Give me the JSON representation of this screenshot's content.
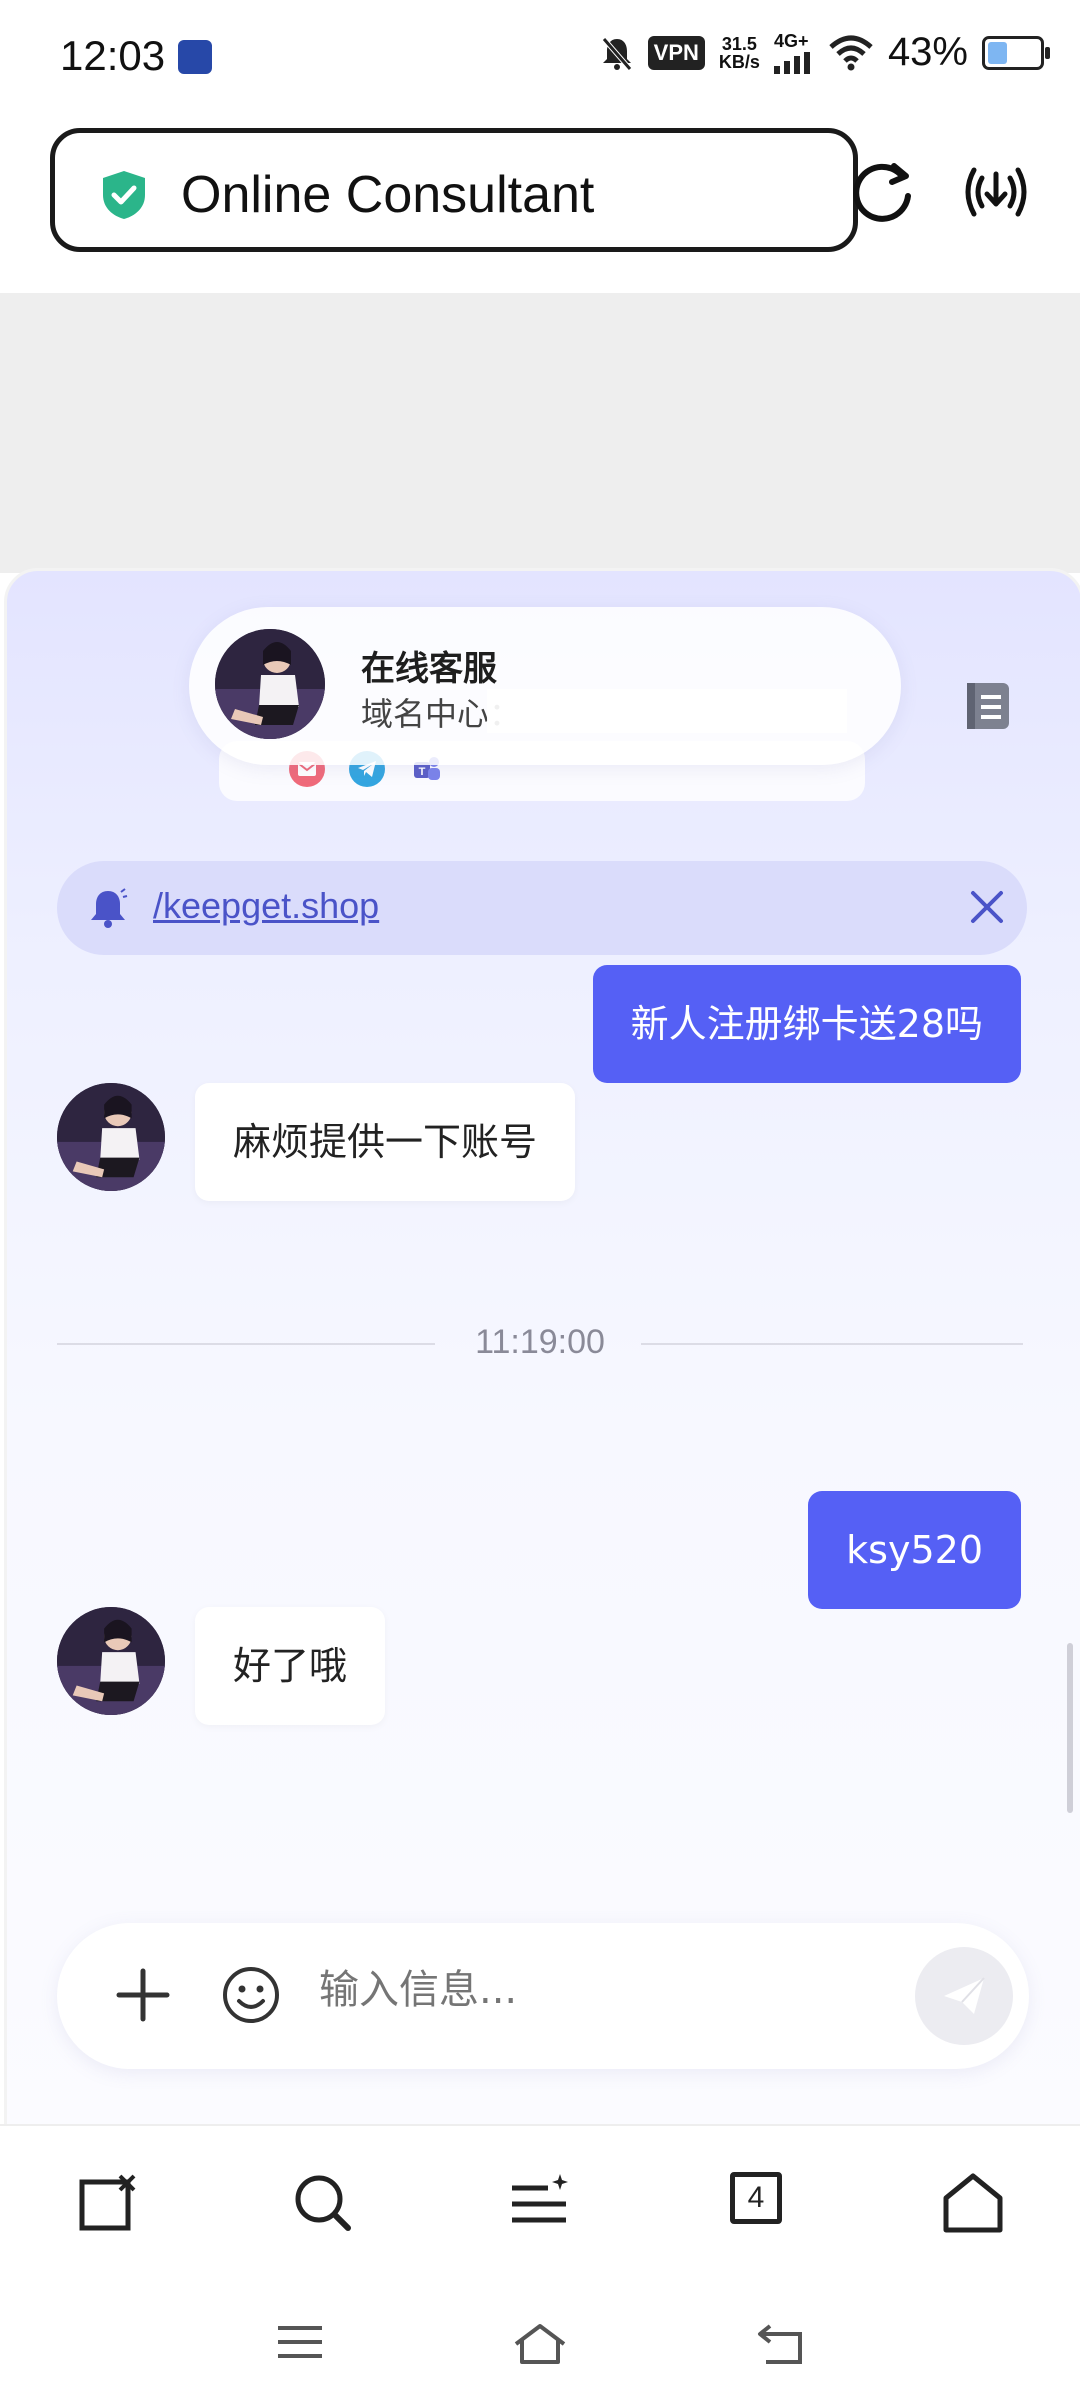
{
  "status_bar": {
    "time": "12:03",
    "vpn": "VPN",
    "net_speed_value": "31.5",
    "net_speed_unit": "KB/s",
    "net_type": "4G+",
    "battery_percent": "43%",
    "battery_level": 0.43
  },
  "url_bar": {
    "title": "Online Consultant"
  },
  "agent": {
    "name": "在线客服",
    "description": "域名中心：",
    "contacts": [
      "email-icon",
      "telegram-icon",
      "teams-icon"
    ]
  },
  "notice": {
    "text": "/keepget.shop"
  },
  "messages": [
    {
      "side": "right",
      "text": "新人注册绑卡送28吗"
    },
    {
      "side": "left",
      "text": "麻烦提供一下账号"
    },
    {
      "side": "divider",
      "text": "11:19:00"
    },
    {
      "side": "right",
      "text": "ksy520"
    },
    {
      "side": "left",
      "text": "好了哦"
    }
  ],
  "input": {
    "placeholder": "输入信息..."
  },
  "browser_nav": {
    "tab_count": "4"
  },
  "colors": {
    "accent": "#5560f5",
    "shield": "#2bb58a",
    "notice_link": "#4a53c8"
  }
}
